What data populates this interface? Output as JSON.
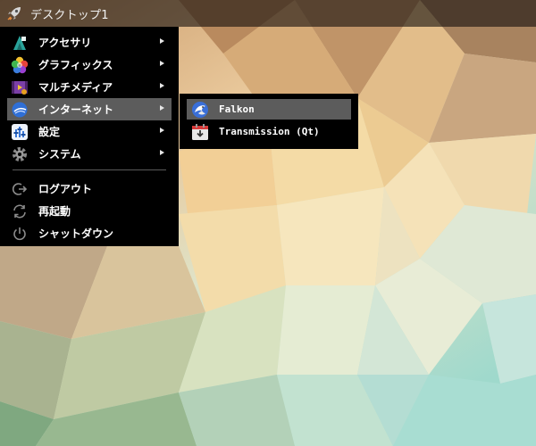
{
  "panel": {
    "title": "デスクトップ1",
    "launcher_icon": "rocket-icon"
  },
  "menu": {
    "items": [
      {
        "label": "アクセサリ",
        "icon": "accessories-icon",
        "has_submenu": true
      },
      {
        "label": "グラフィックス",
        "icon": "graphics-icon",
        "has_submenu": true
      },
      {
        "label": "マルチメディア",
        "icon": "multimedia-icon",
        "has_submenu": true
      },
      {
        "label": "インターネット",
        "icon": "internet-icon",
        "has_submenu": true,
        "active": true
      },
      {
        "label": "設定",
        "icon": "settings-icon",
        "has_submenu": true
      },
      {
        "label": "システム",
        "icon": "system-icon",
        "has_submenu": true
      }
    ],
    "actions": [
      {
        "label": "ログアウト",
        "icon": "logout-icon"
      },
      {
        "label": "再起動",
        "icon": "reboot-icon"
      },
      {
        "label": "シャットダウン",
        "icon": "shutdown-icon"
      }
    ]
  },
  "submenu": {
    "items": [
      {
        "label": "Falkon",
        "icon": "falkon-icon",
        "active": true
      },
      {
        "label": "Transmission (Qt)",
        "icon": "transmission-icon"
      }
    ]
  },
  "colors": {
    "menu_bg": "#000000",
    "highlight": "#5c5c5c",
    "panel_bg": "#120e0c"
  }
}
